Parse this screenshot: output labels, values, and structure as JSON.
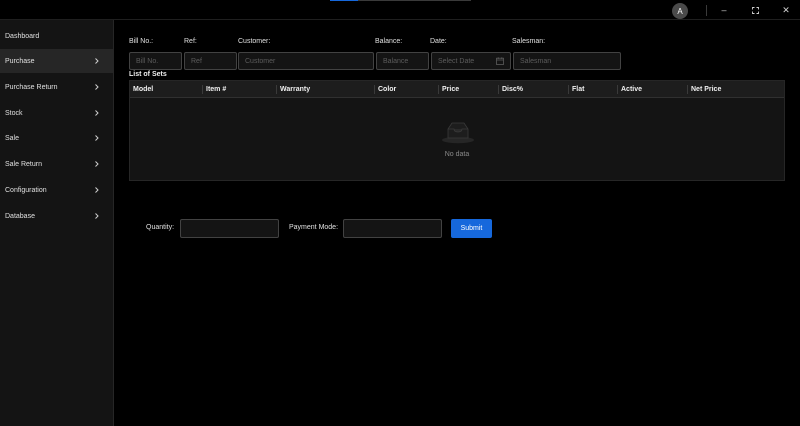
{
  "titlebar": {
    "avatar_initial": "A",
    "minimize_label": "–",
    "close_label": "✕"
  },
  "sidebar": {
    "items": [
      {
        "label": "Dashboard",
        "has_chevron": false
      },
      {
        "label": "Purchase",
        "has_chevron": true,
        "active": true
      },
      {
        "label": "Purchase Return",
        "has_chevron": true
      },
      {
        "label": "Stock",
        "has_chevron": true
      },
      {
        "label": "Sale",
        "has_chevron": true
      },
      {
        "label": "Sale Return",
        "has_chevron": true
      },
      {
        "label": "Configuration",
        "has_chevron": true
      },
      {
        "label": "Database",
        "has_chevron": true
      }
    ]
  },
  "form": {
    "bill_no": {
      "label": "Bill No.:",
      "placeholder": "Bill No."
    },
    "ref": {
      "label": "Ref:",
      "placeholder": "Ref"
    },
    "customer": {
      "label": "Customer:",
      "placeholder": "Customer"
    },
    "balance": {
      "label": "Balance:",
      "placeholder": "Balance"
    },
    "date": {
      "label": "Date:",
      "placeholder": "Select Date"
    },
    "salesman": {
      "label": "Salesman:",
      "placeholder": "Salesman"
    }
  },
  "table": {
    "title": "List of Sets",
    "columns": [
      "Model",
      "Item #",
      "Warranty",
      "Color",
      "Price",
      "Disc%",
      "Flat",
      "Active",
      "Net Price"
    ],
    "rows": [],
    "empty_text": "No data"
  },
  "footer_form": {
    "quantity_label": "Quantity:",
    "quantity_value": "",
    "payment_mode_label": "Payment Mode:",
    "payment_mode_value": "",
    "submit_label": "Submit"
  },
  "colors": {
    "accent": "#1668dc",
    "background": "#000000",
    "sidebar_bg": "#141414",
    "active_item_bg": "#262626"
  },
  "icons": {
    "chevron": "chevron-right-icon",
    "calendar": "calendar-icon",
    "empty": "empty-inbox-icon",
    "maximize": "maximize-icon"
  }
}
